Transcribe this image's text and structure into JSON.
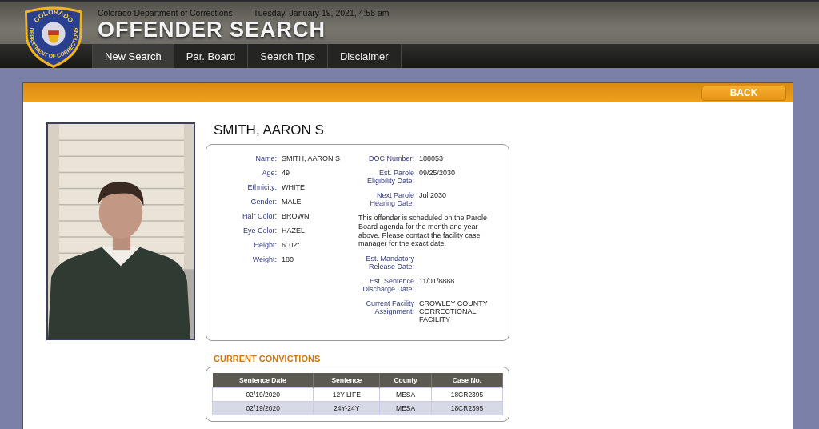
{
  "header": {
    "logo_top": "COLORADO",
    "logo_bottom": "DEPARTMENT OF CORRECTIONS",
    "agency": "Colorado Department of Corrections",
    "datetime": "Tuesday, January 19, 2021, 4:58 am",
    "title": "OFFENDER SEARCH"
  },
  "nav": [
    {
      "label": "New Search",
      "selected": true
    },
    {
      "label": "Par. Board",
      "selected": false
    },
    {
      "label": "Search Tips",
      "selected": false
    },
    {
      "label": "Disclaimer",
      "selected": false
    }
  ],
  "back_button": "BACK",
  "offender_name": "SMITH, AARON S",
  "details_left": [
    {
      "label": "Name:",
      "value": "SMITH, AARON S"
    },
    {
      "label": "Age:",
      "value": "49"
    },
    {
      "label": "Ethnicity:",
      "value": "WHITE"
    },
    {
      "label": "Gender:",
      "value": "MALE"
    },
    {
      "label": "Hair Color:",
      "value": "BROWN"
    },
    {
      "label": "Eye Color:",
      "value": "HAZEL"
    },
    {
      "label": "Height:",
      "value": "6' 02\""
    },
    {
      "label": "Weight:",
      "value": "180"
    }
  ],
  "details_right": [
    {
      "kind": "field",
      "label": "DOC Number:",
      "value": "188053"
    },
    {
      "kind": "field",
      "label": "Est. Parole Eligibility Date:",
      "value": "09/25/2030"
    },
    {
      "kind": "field",
      "label": "Next Parole Hearing Date:",
      "value": "Jul 2030"
    },
    {
      "kind": "note",
      "text": "This offender is scheduled on the Parole Board agenda for the month and year above. Please contact the facility case manager for the exact date."
    },
    {
      "kind": "field",
      "label": "Est. Mandatory Release Date:"
    },
    {
      "kind": "field",
      "label": "Est. Sentence Discharge Date:",
      "value": "11/01/8888"
    },
    {
      "kind": "field",
      "label": "Current Facility Assignment:",
      "value": "CROWLEY COUNTY CORRECTIONAL FACILITY"
    }
  ],
  "convictions": {
    "title": "CURRENT CONVICTIONS",
    "columns": [
      "Sentence Date",
      "Sentence",
      "County",
      "Case No."
    ],
    "rows": [
      [
        "02/19/2020",
        "12Y-LIFE",
        "MESA",
        "18CR2395"
      ],
      [
        "02/19/2020",
        "24Y-24Y",
        "MESA",
        "18CR2395"
      ]
    ]
  }
}
